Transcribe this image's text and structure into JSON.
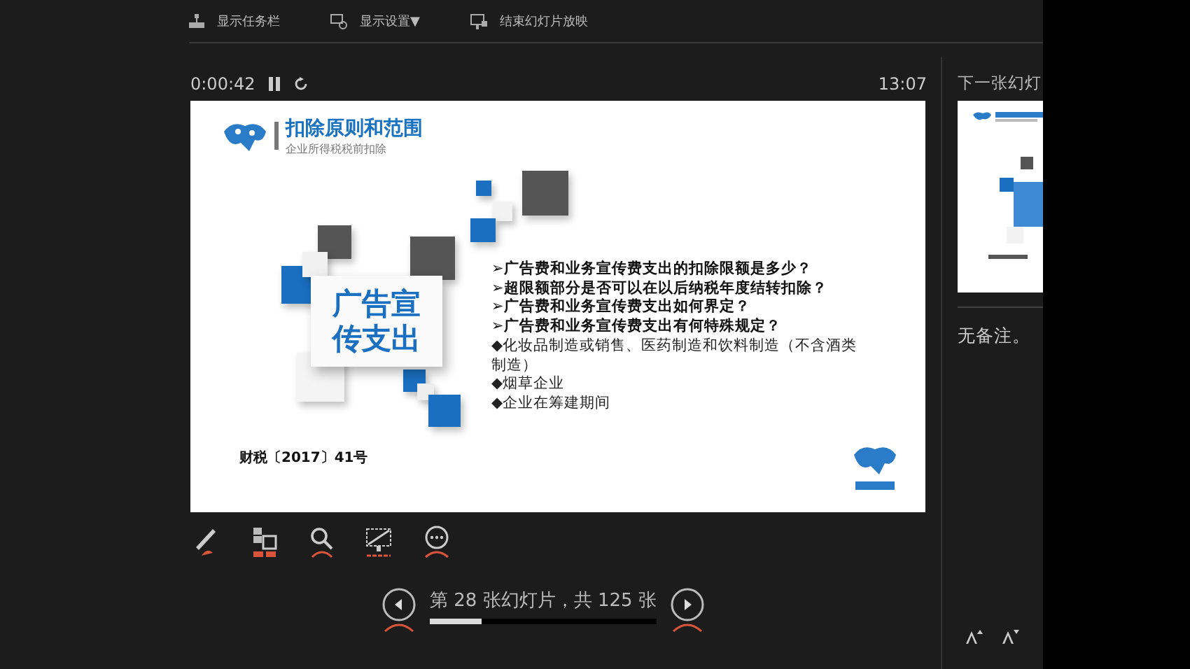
{
  "toolbar": [
    {
      "label": "显示任务栏"
    },
    {
      "label": "显示设置",
      "caret": "▼"
    },
    {
      "label": "结束幻灯片放映"
    }
  ],
  "timer": {
    "elapsed": "0:00:42",
    "clock": "13:07"
  },
  "slide": {
    "title": "扣除原则和范围",
    "subtitle": "企业所得税税前扣除",
    "box_lines": [
      "广告宣",
      "传支出"
    ],
    "questions": [
      "➢广告费和业务宣传费支出的扣除限额是多少？",
      "➢超限额部分是否可以在以后纳税年度结转扣除？",
      "➢广告费和业务宣传费支出如何界定？",
      "➢广告费和业务宣传费支出有何特殊规定？"
    ],
    "bullets": [
      "◆化妆品制造或销售、医药制造和饮料制造（不含酒类制造）",
      "◆烟草企业",
      "◆企业在筹建期间"
    ],
    "footer": "财税〔2017〕41号"
  },
  "navigation": {
    "status": "第 28 张幻灯片，共 125 张",
    "level": 0.23
  },
  "next_slide": {
    "label": "下一张幻灯"
  },
  "notes": "无备注。"
}
